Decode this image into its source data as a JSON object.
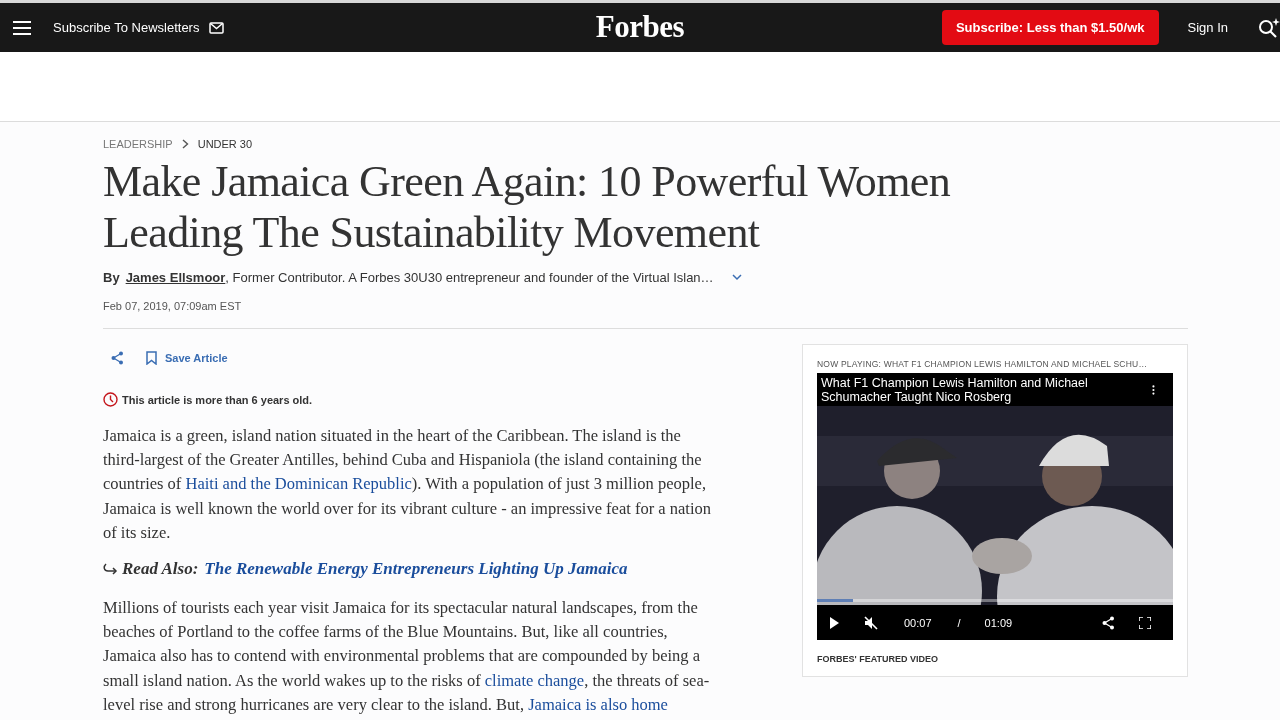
{
  "header": {
    "newsletter_label": "Subscribe To Newsletters",
    "logo": "Forbes",
    "subscribe_button": "Subscribe: Less than $1.50/wk",
    "sign_in": "Sign In"
  },
  "breadcrumb": [
    {
      "label": "LEADERSHIP"
    },
    {
      "label": "UNDER 30"
    }
  ],
  "title": "Make Jamaica Green Again: 10 Powerful Women Leading The Sustainability Movement",
  "byline": {
    "prefix": "By",
    "author": "James Ellsmoor",
    "description": ", Former Contributor. A Forbes 30U30 entrepreneur and founder of the Virtual Islan…"
  },
  "date": "Feb 07, 2019, 07:09am EST",
  "actions": {
    "save_label": "Save Article"
  },
  "age_notice": "This article is more than 6 years old.",
  "body": [
    {
      "kind": "paragraph",
      "segments": [
        {
          "text": "Jamaica is a green, island nation situated in the heart of the Caribbean. The island is the third-largest of the Greater Antilles, behind Cuba and Hispaniola (the island containing the countries of ",
          "link": false
        },
        {
          "text": "Haiti and the Dominican Republic",
          "link": true
        },
        {
          "text": "). With a population of just 3 million people, Jamaica is well known the world over for its vibrant culture - an impressive feat for a nation of its size.",
          "link": false
        }
      ]
    },
    {
      "kind": "read_also",
      "label": "Read Also:",
      "link": "The Renewable Energy Entrepreneurs Lighting Up Jamaica"
    },
    {
      "kind": "paragraph",
      "segments": [
        {
          "text": "Millions of tourists each year visit Jamaica for its spectacular natural landscapes, from the beaches of Portland to the coffee farms of the Blue Mountains. But, like all countries, Jamaica also has to contend with environmental problems that are compounded by being a small island nation. As the world wakes up to the risks of ",
          "link": false
        },
        {
          "text": "climate change",
          "link": true
        },
        {
          "text": ", the threats of sea-level rise and strong hurricanes are very clear to the island. But, ",
          "link": false
        },
        {
          "text": "Jamaica is also home",
          "link": true
        }
      ]
    }
  ],
  "video": {
    "now_playing": "NOW PLAYING: WHAT F1 CHAMPION LEWIS HAMILTON AND MICHAEL SCHU…",
    "title": "What F1 Champion Lewis Hamilton and Michael Schumacher Taught Nico Rosberg",
    "muted": true,
    "progress": {
      "level": 0.1
    },
    "current_time": "00:07",
    "separator": "/",
    "duration": "01:09",
    "caption": "FORBES' FEATURED VIDEO"
  }
}
